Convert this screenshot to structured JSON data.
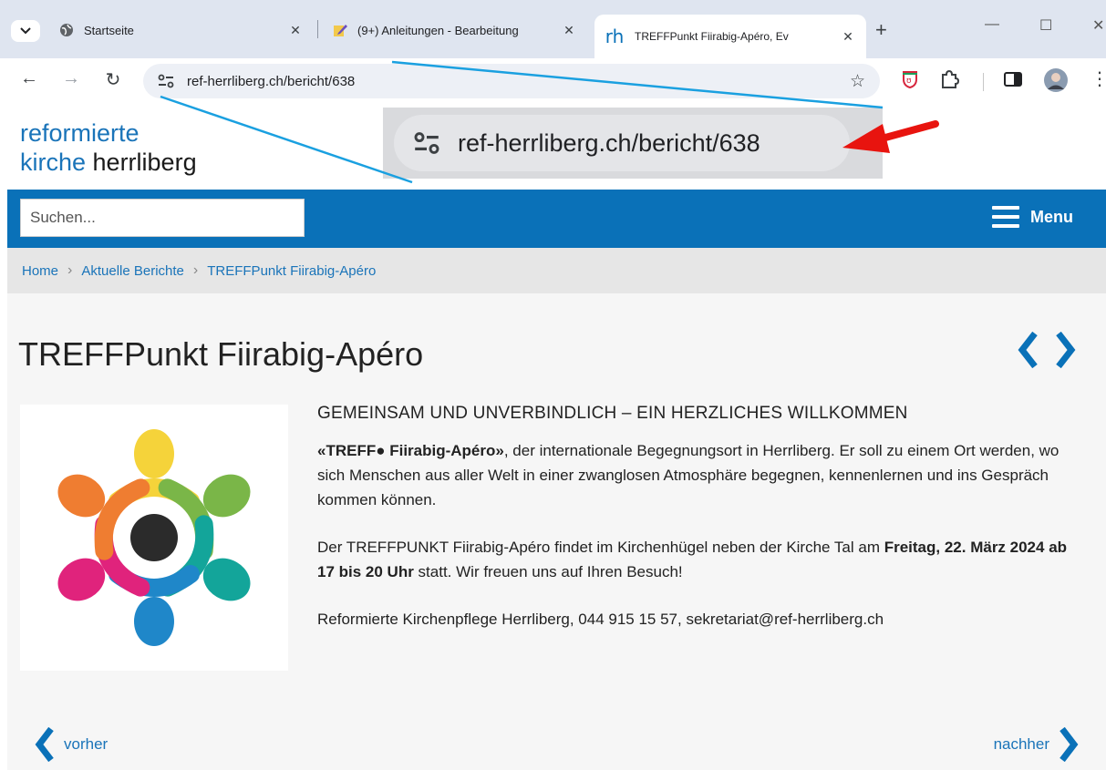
{
  "browser": {
    "tabs": [
      {
        "title": "Startseite"
      },
      {
        "title": "(9+) Anleitungen - Bearbeitung"
      },
      {
        "title": "TREFFPunkt Fiirabig-Apéro, Ev"
      }
    ],
    "active_tab_favicon": "rh",
    "url": "ref-herrliberg.ch/bericht/638"
  },
  "site": {
    "logo_line1": "reformierte",
    "logo_line2_blue": "kirche",
    "logo_line2_rest": " herrliberg",
    "search_placeholder": "Suchen...",
    "menu_label": "Menu",
    "breadcrumb": [
      "Home",
      "Aktuelle Berichte",
      "TREFFPunkt Fiirabig-Apéro"
    ]
  },
  "article": {
    "title": "TREFFPunkt Fiirabig-Apéro",
    "heading": "GEMEINSAM UND UNVERBINDLICH – EIN HERZLICHES WILLKOMMEN",
    "p1_bold": "«TREFF● Fiirabig-Apéro»",
    "p1_rest": ", der internationale Begegnungsort in Herrliberg. Er soll zu einem Ort werden, wo sich Menschen aus aller Welt in einer zwanglosen Atmosphäre begegnen, kennenlernen und ins Gespräch kommen können.",
    "p2_start": "Der TREFFPUNKT Fiirabig-Apéro findet im Kirchenhügel neben der Kirche Tal am ",
    "p2_bold": "Freitag, 22. März 2024 ab 17 bis 20 Uhr",
    "p2_end": " statt. Wir freuen uns auf Ihren Besuch!",
    "p3": "Reformierte Kirchenpflege Herrliberg, 044 915 15 57, sekretariat@ref-herrliberg.ch",
    "prev_label": "vorher",
    "next_label": "nachher"
  },
  "annotation": {
    "zoom_url": "ref-herrliberg.ch/bericht/638",
    "arrow_color": "#e8140f",
    "line_color": "#1aa0e0"
  },
  "colors": {
    "brand_blue": "#0a71b8",
    "link_blue": "#1a74b9"
  }
}
